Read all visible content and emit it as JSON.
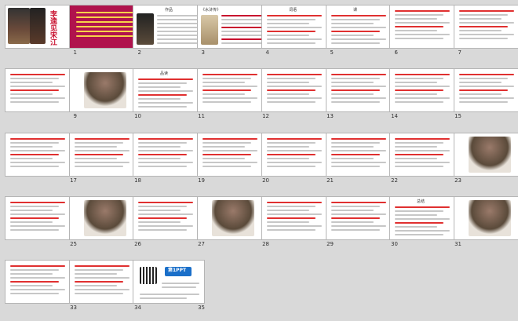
{
  "slides": [
    {
      "n": "1",
      "type": "cover",
      "t": "李逵见宋江",
      "sub": "",
      "bg": "#ffffff"
    },
    {
      "n": "2",
      "type": "text",
      "t": "诗代鲁迅小说",
      "sub": "",
      "bg": "#b0134d"
    },
    {
      "n": "3",
      "type": "ppl",
      "t": "作品",
      "sub": "",
      "bg": "#ffffff"
    },
    {
      "n": "4",
      "type": "doc",
      "t": "《水浒传》",
      "sub": "",
      "bg": "#ffffff"
    },
    {
      "n": "5",
      "type": "text",
      "t": "词语",
      "sub": "",
      "bg": "#ffffff"
    },
    {
      "n": "6",
      "type": "text",
      "t": "课",
      "sub": "",
      "bg": "#ffffff"
    },
    {
      "n": "7",
      "type": "text",
      "t": "",
      "sub": "",
      "bg": "#ffffff"
    },
    {
      "n": "8",
      "type": "text",
      "t": "",
      "sub": "",
      "bg": "#ffffff"
    },
    {
      "n": "9",
      "type": "text",
      "t": "",
      "sub": "",
      "bg": "#ffffff"
    },
    {
      "n": "10",
      "type": "photo",
      "t": "",
      "sub": "",
      "bg": "#ffffff"
    },
    {
      "n": "11",
      "type": "text",
      "t": "品读",
      "sub": "",
      "bg": "#ffffff"
    },
    {
      "n": "12",
      "type": "text",
      "t": "",
      "sub": "",
      "bg": "#ffffff"
    },
    {
      "n": "13",
      "type": "text",
      "t": "",
      "sub": "",
      "bg": "#ffffff"
    },
    {
      "n": "14",
      "type": "text",
      "t": "",
      "sub": "",
      "bg": "#ffffff"
    },
    {
      "n": "15",
      "type": "text",
      "t": "",
      "sub": "",
      "bg": "#ffffff"
    },
    {
      "n": "16",
      "type": "text",
      "t": "",
      "sub": "",
      "bg": "#ffffff"
    },
    {
      "n": "17",
      "type": "text",
      "t": "",
      "sub": "",
      "bg": "#ffffff"
    },
    {
      "n": "18",
      "type": "text",
      "t": "",
      "sub": "",
      "bg": "#ffffff"
    },
    {
      "n": "19",
      "type": "text",
      "t": "",
      "sub": "",
      "bg": "#ffffff"
    },
    {
      "n": "20",
      "type": "text",
      "t": "",
      "sub": "",
      "bg": "#ffffff"
    },
    {
      "n": "21",
      "type": "text",
      "t": "",
      "sub": "",
      "bg": "#ffffff"
    },
    {
      "n": "22",
      "type": "text",
      "t": "",
      "sub": "",
      "bg": "#ffffff"
    },
    {
      "n": "23",
      "type": "text",
      "t": "",
      "sub": "",
      "bg": "#ffffff"
    },
    {
      "n": "24",
      "type": "photo",
      "t": "",
      "sub": "",
      "bg": "#ffffff"
    },
    {
      "n": "25",
      "type": "text",
      "t": "",
      "sub": "",
      "bg": "#ffffff"
    },
    {
      "n": "26",
      "type": "photo",
      "t": "",
      "sub": "",
      "bg": "#ffffff"
    },
    {
      "n": "27",
      "type": "text",
      "t": "",
      "sub": "",
      "bg": "#ffffff"
    },
    {
      "n": "28",
      "type": "photo",
      "t": "",
      "sub": "",
      "bg": "#ffffff"
    },
    {
      "n": "29",
      "type": "text",
      "t": "",
      "sub": "",
      "bg": "#ffffff"
    },
    {
      "n": "30",
      "type": "text",
      "t": "",
      "sub": "",
      "bg": "#ffffff"
    },
    {
      "n": "31",
      "type": "text",
      "t": "总结",
      "sub": "",
      "bg": "#ffffff"
    },
    {
      "n": "32",
      "type": "photo",
      "t": "",
      "sub": "",
      "bg": "#ffffff"
    },
    {
      "n": "33",
      "type": "text",
      "t": "",
      "sub": "",
      "bg": "#ffffff"
    },
    {
      "n": "34",
      "type": "text",
      "t": "",
      "sub": "",
      "bg": "#ffffff"
    },
    {
      "n": "35",
      "type": "ppt",
      "t": "第1PPT",
      "sub": "",
      "bg": "#ffffff"
    }
  ]
}
